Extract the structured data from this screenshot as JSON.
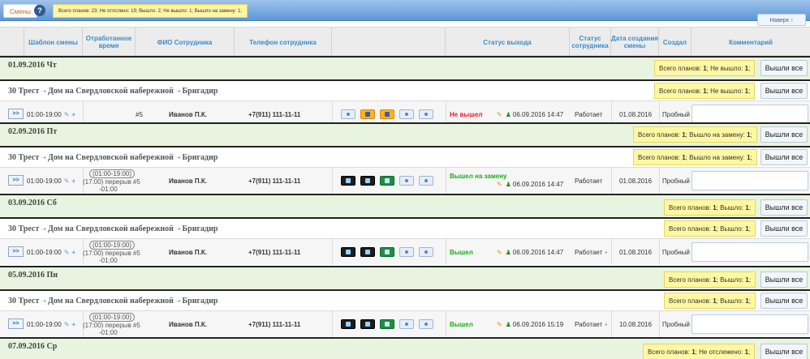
{
  "topbar": {
    "tab_label": "Смены",
    "help_label": "?",
    "summary": "Всего планов: 23; Не отлслено: 19; Вышло: 2; Не вышло: 1; Вышло на замену: 1;",
    "up_label": "Наверх ↑"
  },
  "columns": {
    "template": "Шаблон смены",
    "worked": "Отработанное время",
    "fio": "ФИО Сотрудника",
    "phone": "Телефон сотрудника",
    "status": "Статус выхода",
    "emp_status": "Статус сотрудника",
    "created_date": "Дата создания смены",
    "created_by": "Создал",
    "comment": "Комментарий"
  },
  "all_button": "Вышли все",
  "group_text": {
    "part1": "30 Трест",
    "part2": "Дом на Свердловской набережной",
    "part3": "Бригадир",
    "arrow": "➝"
  },
  "days": [
    {
      "date": "01.09.2016 Чт",
      "summary_pre": "Всего планов: ",
      "summary_total": "1",
      "summary_mid": "; Не вышло: ",
      "summary_value": "1",
      "summary_post": ";",
      "group_summary_pre": "Всего планов: ",
      "group_summary_total": "1",
      "group_summary_mid": "; Не вышло: ",
      "group_summary_value": "1",
      "group_summary_post": ";",
      "shift": {
        "expand": ">>",
        "time": "01:00-19:00",
        "worked_num": "#5",
        "fio": "Иванов П.К.",
        "phone": "+7(911) 111-11-11",
        "status": "Не вышел",
        "status_ts": "06.09.2016 14:47",
        "emp_status": "Работает",
        "created": "01.08.2016",
        "author": "Пробный"
      }
    },
    {
      "date": "02.09.2016 Пт",
      "summary_pre": "Всего планов: ",
      "summary_total": "1",
      "summary_mid": "; Вышло на замену: ",
      "summary_value": "1",
      "summary_post": ";",
      "group_summary_pre": "Всего планов: ",
      "group_summary_total": "1",
      "group_summary_mid": "; Вышло на замену: ",
      "group_summary_value": "1",
      "group_summary_post": ";",
      "shift": {
        "expand": ">>",
        "time": "01:00-19:00",
        "worked_range": "(01:00-19:00)",
        "worked_break": "(17:00) перерыв #5",
        "worked_extra": "-01:00",
        "fio": "Иванов П.К.",
        "phone": "+7(911) 111-11-11",
        "status": "Вышел на замену",
        "status_ts": "06.09.2016 14:47",
        "emp_status": "Работает",
        "created": "01.08.2016",
        "author": "Пробный"
      }
    },
    {
      "date": "03.09.2016 Сб",
      "summary_pre": "Всего планов: ",
      "summary_total": "1",
      "summary_mid": "; Вышло: ",
      "summary_value": "1",
      "summary_post": ";",
      "group_summary_pre": "Всего планов: ",
      "group_summary_total": "1",
      "group_summary_mid": "; Вышло: ",
      "group_summary_value": "1",
      "group_summary_post": ";",
      "shift": {
        "expand": ">>",
        "time": "01:00-19:00",
        "worked_range": "(01:00-19:00)",
        "worked_break": "(17:00) перерыв #5",
        "worked_extra": "-01:00",
        "fio": "Иванов П.К.",
        "phone": "+7(911) 111-11-11",
        "status": "Вышел",
        "status_ts": "06.09.2016 14:47",
        "emp_status": "Работает",
        "created": "01.08.2016",
        "author": "Пробный"
      }
    },
    {
      "date": "05.09.2016 Пн",
      "summary_pre": "Всего планов: ",
      "summary_total": "1",
      "summary_mid": "; Вышло: ",
      "summary_value": "1",
      "summary_post": ";",
      "group_summary_pre": "Всего планов: ",
      "group_summary_total": "1",
      "group_summary_mid": "; Вышло: ",
      "group_summary_value": "1",
      "group_summary_post": ";",
      "shift": {
        "expand": ">>",
        "time": "01:00-19:00",
        "worked_range": "(01:00-19:00)",
        "worked_break": "(17:00) перерыв #5",
        "worked_extra": "-01:00",
        "fio": "Иванов П.К.",
        "phone": "+7(911) 111-11-11",
        "status": "Вышел",
        "status_ts": "06.09.2016 15:19",
        "emp_status": "Работает",
        "created": "10.08.2016",
        "author": "Пробный"
      }
    },
    {
      "date": "07.09.2016 Ср",
      "summary_pre": "Всего планов: ",
      "summary_total": "1",
      "summary_mid": "; Не отслежено: ",
      "summary_value": "1",
      "summary_post": ";"
    }
  ]
}
